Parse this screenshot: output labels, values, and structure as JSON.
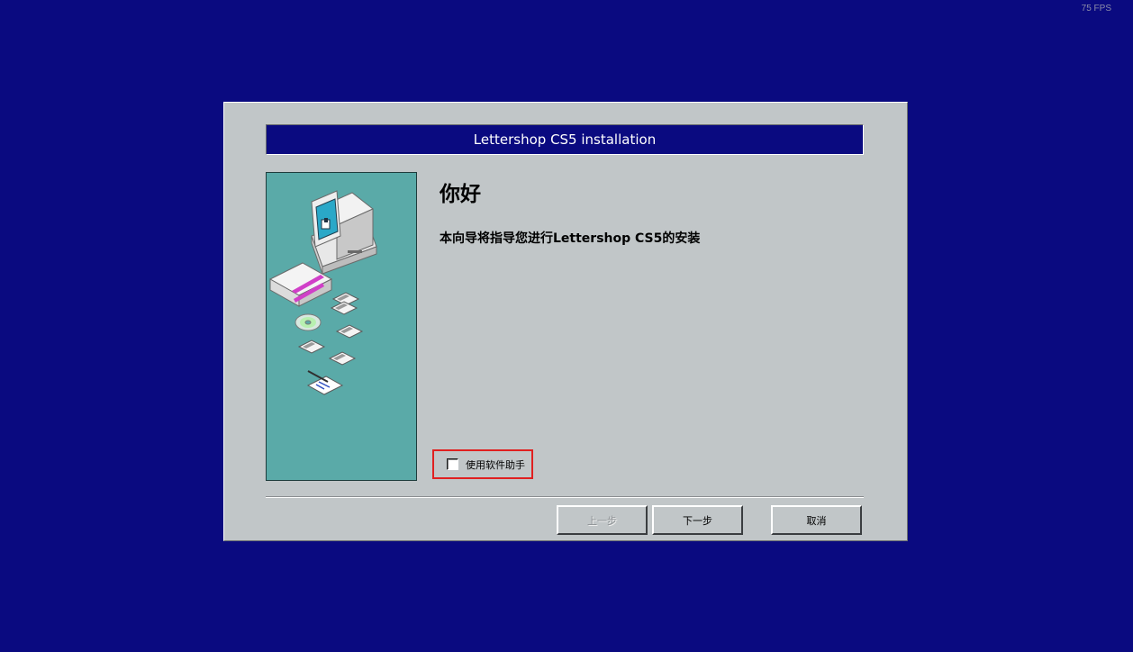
{
  "overlay": {
    "fps": "75 FPS"
  },
  "dialog": {
    "title": "Lettershop CS5 installation",
    "heading": "你好",
    "description": "本向导将指导您进行Lettershop CS5的安装",
    "assistant_checkbox": {
      "label": "使用软件助手",
      "checked": false
    },
    "buttons": {
      "back": {
        "label": "上一步",
        "enabled": false
      },
      "next": {
        "label": "下一步",
        "enabled": true
      },
      "cancel": {
        "label": "取消",
        "enabled": true
      }
    }
  },
  "colors": {
    "desktop": "#0a0a80",
    "title_bar": "#0a0a80",
    "dialog_face": "#c1c6c8",
    "side_panel": "#5aaaa8",
    "highlight_border": "#e02020"
  },
  "illustration": {
    "icons": [
      "computer-icon",
      "software-box-icon",
      "cd-icon",
      "floppy-disk-icon",
      "document-icon"
    ]
  }
}
